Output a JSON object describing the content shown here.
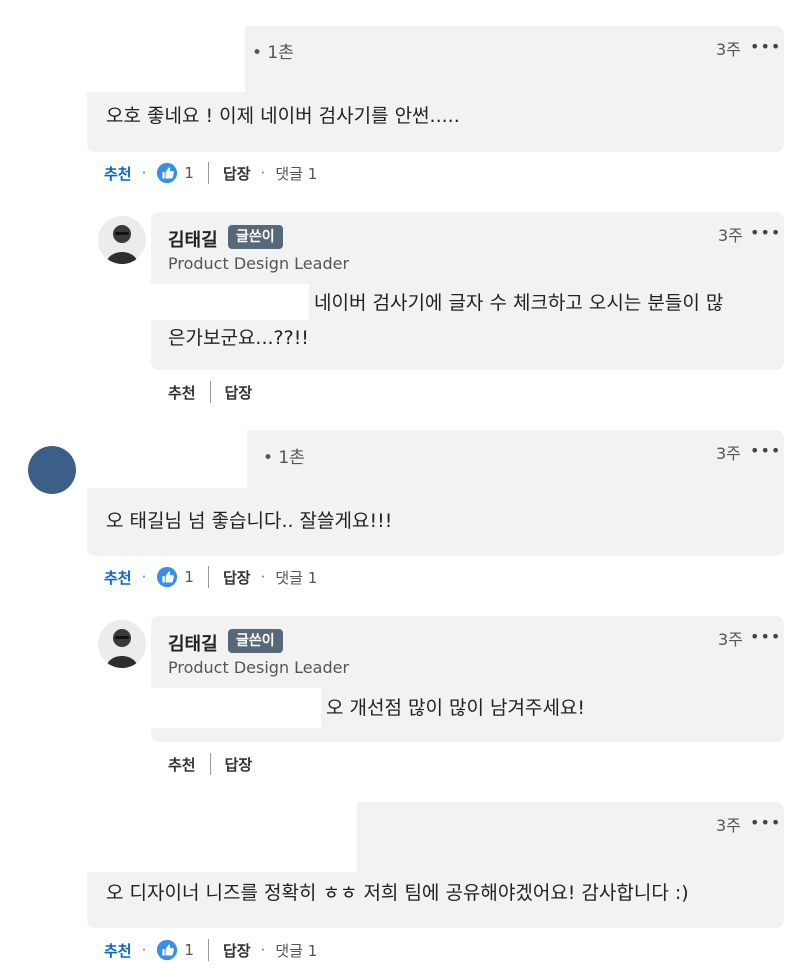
{
  "comments": [
    {
      "degree": "• 1촌",
      "time": "3주",
      "more": "•••",
      "text": "오호 좋네요 ! 이제 네이버 검사기를 안썬.....",
      "actions": {
        "like": "추천",
        "dot": "·",
        "count": "1",
        "reply": "답장",
        "replies": "댓글 1"
      },
      "reply": {
        "author": "김태길",
        "badge": "글쓴이",
        "headline": "Product Design Leader",
        "time": "3주",
        "more": "•••",
        "text_line1": "네이버 검사기에 글자 수 체크하고 오시는 분들이 많",
        "text_line2": "은가보군요...??!!",
        "actions": {
          "like": "추천",
          "reply": "답장"
        }
      }
    },
    {
      "degree": "• 1촌",
      "time": "3주",
      "more": "•••",
      "text": "오 태길님 넘 좋습니다.. 잘쓸게요!!!",
      "actions": {
        "like": "추천",
        "dot": "·",
        "count": "1",
        "reply": "답장",
        "replies": "댓글 1"
      },
      "reply": {
        "author": "김태길",
        "badge": "글쓴이",
        "headline": "Product Design Leader",
        "time": "3주",
        "more": "•••",
        "text": "오 개선점 많이 많이 남겨주세요!",
        "actions": {
          "like": "추천",
          "reply": "답장"
        }
      }
    },
    {
      "time": "3주",
      "more": "•••",
      "text": "오 디자이너 니즈를 정확히 ㅎㅎ 저희 팀에 공유해야겠어요! 감사합니다 :)",
      "actions": {
        "like": "추천",
        "dot": "·",
        "count": "1",
        "reply": "답장",
        "replies": "댓글 1"
      }
    }
  ],
  "colors": {
    "bubble": "#f2f2f2",
    "like_blue": "#0a66c2",
    "badge_bg": "#56687a"
  },
  "icons": {
    "like": "thumbs-up-icon",
    "more": "more-horizontal-icon",
    "avatar": "user-avatar"
  }
}
